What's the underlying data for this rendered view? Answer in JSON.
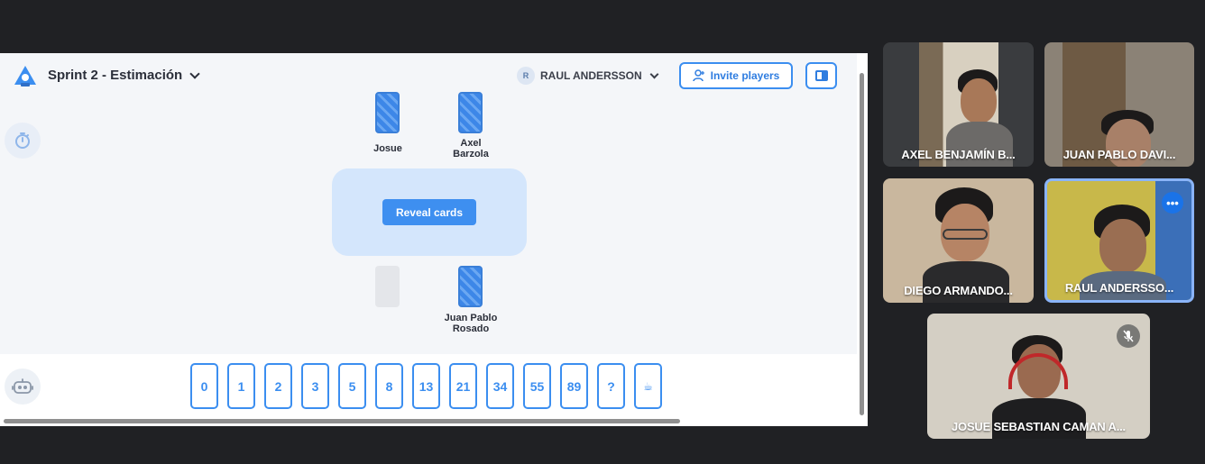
{
  "game": {
    "title": "Sprint 2 - Estimación",
    "user_initial": "R",
    "user_name": "RAUL ANDERSSON",
    "invite_label": "Invite players",
    "reveal_label": "Reveal cards"
  },
  "players": {
    "top_left": "Josue",
    "top_right": "Axel\nBarzola",
    "bottom_right": "Juan Pablo\nRosado"
  },
  "deck": [
    "0",
    "1",
    "2",
    "3",
    "5",
    "8",
    "13",
    "21",
    "34",
    "55",
    "89",
    "?",
    "☕"
  ],
  "participants": [
    {
      "name": "AXEL BENJAMÍN B..."
    },
    {
      "name": "JUAN PABLO DAVI..."
    },
    {
      "name": "DIEGO ARMANDO..."
    },
    {
      "name": "RAUL ANDERSSO..."
    },
    {
      "name": "JOSUE SEBASTIAN CAMAN A..."
    }
  ],
  "colors": {
    "accent": "#3b8ef0",
    "meet_bg": "#202124",
    "active_border": "#8ab4f8"
  }
}
